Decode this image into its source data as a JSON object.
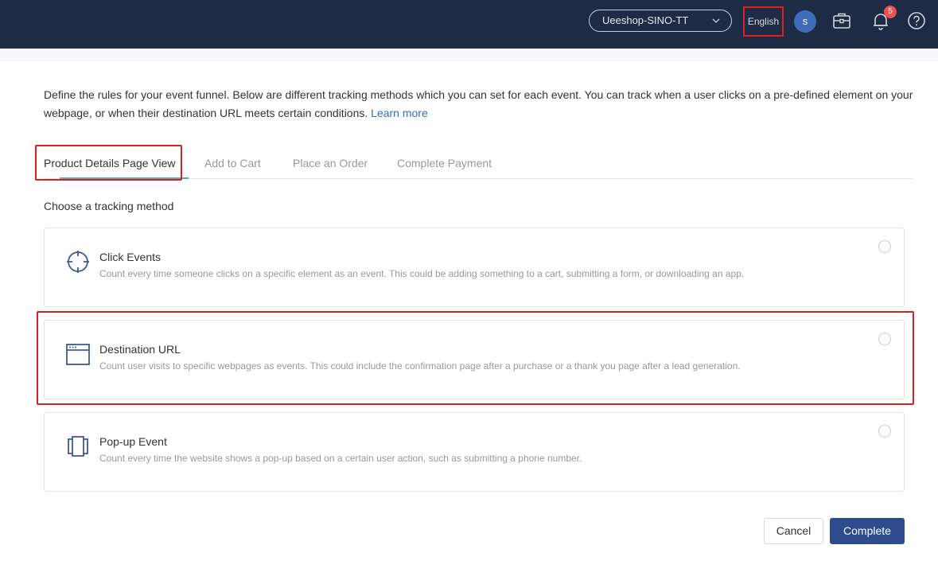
{
  "header": {
    "shop_name": "Ueeshop-SINO-TT",
    "language": "English",
    "avatar_initial": "s",
    "notification_count": "5"
  },
  "intro": {
    "text": "Define the rules for your event funnel. Below are different tracking methods which you can set for each event. You can track when a user clicks on a pre-defined element on your webpage, or when their destination URL meets certain conditions.",
    "link": "Learn more"
  },
  "tabs": [
    {
      "label": "Product Details Page View",
      "active": true
    },
    {
      "label": "Add to Cart",
      "active": false
    },
    {
      "label": "Place an Order",
      "active": false
    },
    {
      "label": "Complete Payment",
      "active": false
    }
  ],
  "section_label": "Choose a tracking method",
  "methods": [
    {
      "icon": "crosshair-icon",
      "title": "Click Events",
      "description": "Count every time someone clicks on a specific element as an event. This could be adding something to a cart, submitting a form, or downloading an app."
    },
    {
      "icon": "browser-window-icon",
      "title": "Destination URL",
      "description": "Count user visits to specific webpages as events. This could include the confirmation page after a purchase or a thank you page after a lead generation."
    },
    {
      "icon": "popup-icon",
      "title": "Pop-up Event",
      "description": "Count every time the website shows a pop-up based on a certain user action, such as submitting a phone number."
    }
  ],
  "actions": {
    "cancel": "Cancel",
    "complete": "Complete"
  },
  "colors": {
    "header_bg": "#1d2b45",
    "accent": "#2e4b8e",
    "link": "#2f6fc8",
    "highlight": "#e02020"
  }
}
